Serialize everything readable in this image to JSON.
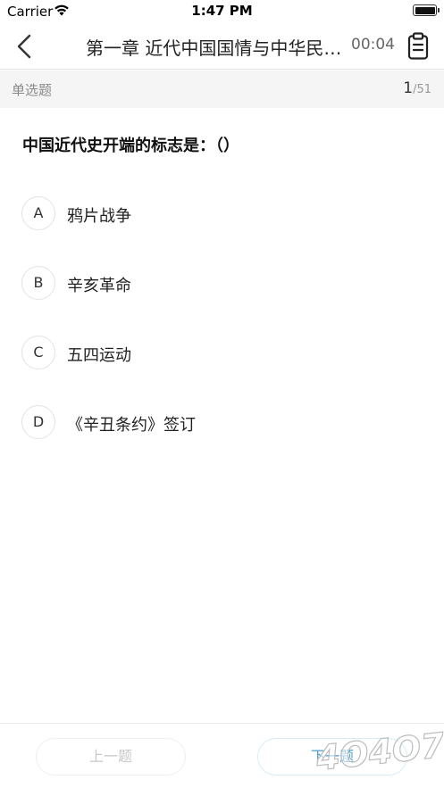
{
  "status_bar": {
    "carrier": "Carrier",
    "time": "1:47 PM"
  },
  "nav": {
    "title": "第一章 近代中国国情与中华民族复兴",
    "timer": "00:04"
  },
  "question_header": {
    "type": "单选题",
    "current": "1",
    "total": "/51"
  },
  "question": {
    "text": "中国近代史开端的标志是：（）",
    "options": [
      {
        "letter": "A",
        "text": "鸦片战争"
      },
      {
        "letter": "B",
        "text": "辛亥革命"
      },
      {
        "letter": "C",
        "text": "五四运动"
      },
      {
        "letter": "D",
        "text": "《辛丑条约》签订"
      }
    ]
  },
  "footer": {
    "prev_label": "上一题",
    "next_label": "下一题"
  },
  "watermark": {
    "text": "4ᴏ4ᴏ7"
  },
  "colors": {
    "accent": "#4a9fd0",
    "type_bar_bg": "#f5f5f5",
    "watermark": "#c9c9c9"
  }
}
